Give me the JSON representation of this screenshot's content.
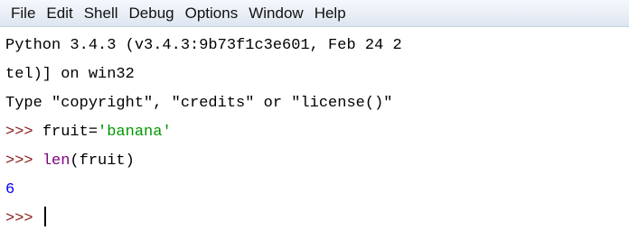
{
  "menu": {
    "items": [
      "File",
      "Edit",
      "Shell",
      "Debug",
      "Options",
      "Window",
      "Help"
    ]
  },
  "shell": {
    "banner_line1": "Python 3.4.3 (v3.4.3:9b73f1c3e601, Feb 24 2",
    "banner_line2": "tel)] on win32",
    "banner_line3": "Type \"copyright\", \"credits\" or \"license()\" ",
    "prompt": ">>> ",
    "cmd1_var": "fruit=",
    "cmd1_string": "'banana'",
    "cmd2_builtin": "len",
    "cmd2_args": "(fruit)",
    "output1": "6"
  },
  "colors": {
    "prompt": "#8b1a1a",
    "string": "#009900",
    "builtin": "#800080",
    "output": "#0000ff"
  }
}
